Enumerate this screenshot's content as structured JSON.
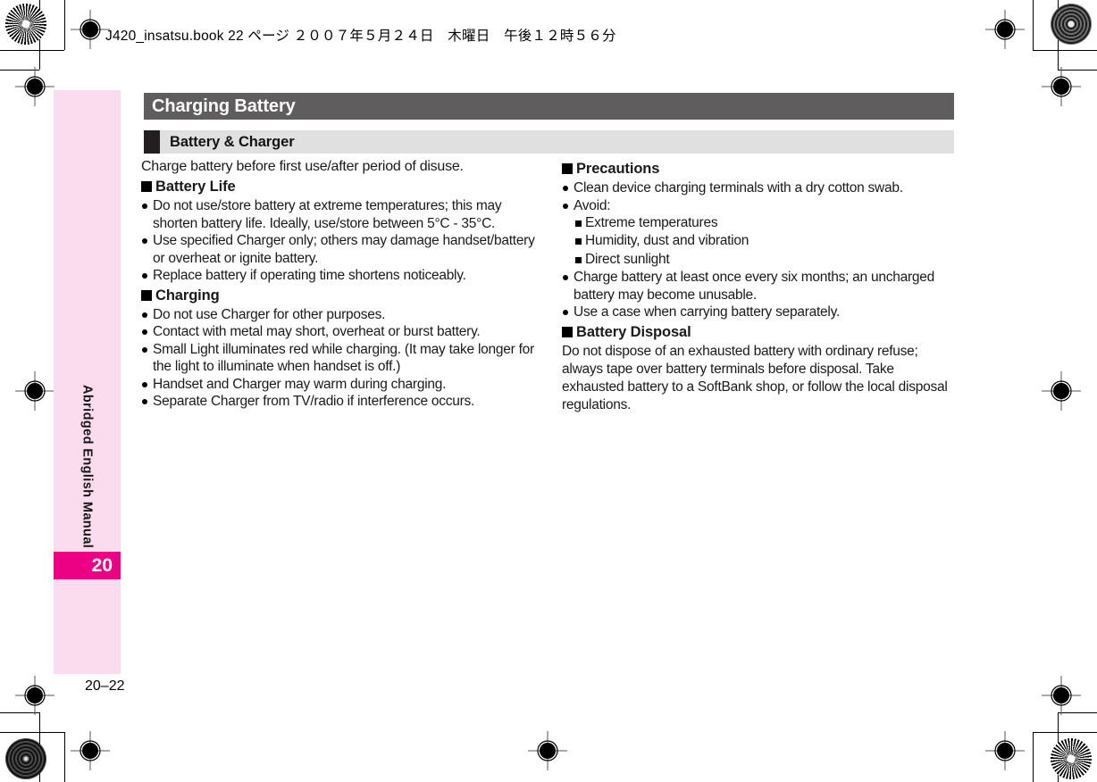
{
  "running_header": "J420_insatsu.book  22 ページ  ２００７年５月２４日　木曜日　午後１２時５６分",
  "side_tab": {
    "label": "Abridged English Manual",
    "page_number": "20",
    "band_color": "#fadcee",
    "tab_color": "#ec0084"
  },
  "folio": "20–22",
  "chapter": {
    "title": "Charging Battery",
    "bar_color": "#5f5d5d"
  },
  "section": {
    "title": "Battery & Charger",
    "bar_color": "#e0e0e0",
    "marker_color": "#231f20"
  },
  "left_column": {
    "lead": "Charge battery before first use/after period of disuse.",
    "groups": [
      {
        "heading": "Battery Life",
        "items": [
          "Do not use/store battery at extreme temperatures; this may shorten battery life. Ideally, use/store between 5°C - 35°C.",
          "Use specified Charger only; others may damage handset/battery or overheat or ignite battery.",
          "Replace battery if operating time shortens noticeably."
        ]
      },
      {
        "heading": "Charging",
        "items": [
          "Do not use Charger for other purposes.",
          "Contact with metal may short, overheat or burst battery.",
          "Small Light illuminates red while charging. (It may take longer for the light to illuminate when handset is off.)",
          "Handset and Charger may warm during charging.",
          "Separate Charger from TV/radio if interference occurs."
        ]
      }
    ]
  },
  "right_column": {
    "precautions": {
      "heading": "Precautions",
      "item_1": "Clean device charging terminals with a dry cotton swab.",
      "item_2": "Avoid:",
      "avoid_items": [
        "Extreme temperatures",
        "Humidity, dust and vibration",
        "Direct sunlight"
      ],
      "item_3": "Charge battery at least once every six months; an uncharged battery may become unusable.",
      "item_4": "Use a case when carrying battery separately."
    },
    "disposal": {
      "heading": "Battery Disposal",
      "text": "Do not dispose of an exhausted battery with ordinary refuse; always tape over battery terminals before disposal. Take exhausted battery to a SoftBank shop, or follow the local disposal regulations."
    }
  }
}
